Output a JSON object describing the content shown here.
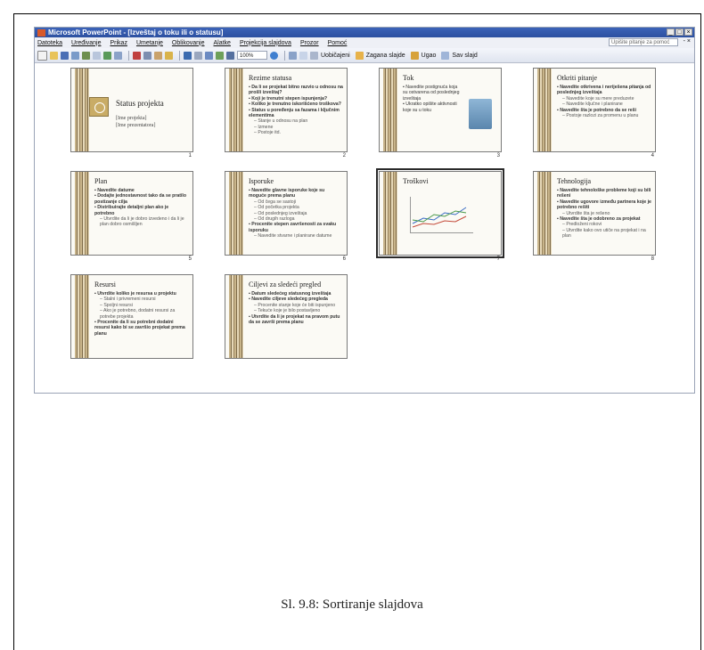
{
  "window": {
    "title": "Microsoft PowerPoint - [Izveštaj o toku ili o statusu]",
    "controls": [
      "_",
      "□",
      "×"
    ]
  },
  "menu": {
    "items": [
      "Datoteka",
      "Uređivanje",
      "Prikaz",
      "Umetanje",
      "Oblikovanje",
      "Alatke",
      "Projekcija slajdova",
      "Prozor",
      "Pomoć"
    ],
    "ask_placeholder": "Upišite pitanje za pomoć",
    "close_doc": "- ×"
  },
  "toolbar": {
    "zoom": "100%",
    "labels": [
      "Uobičajeni",
      "Zagana slajde",
      "Ugao",
      "Sav slajd"
    ]
  },
  "slides": [
    {
      "num": "1",
      "title": "Status projekta",
      "subtitle": [
        "[Ime projekta]",
        "[Ime prezentatora]"
      ]
    },
    {
      "num": "2",
      "title": "Rezime statusa",
      "bullets": [
        {
          "t": "Da li se projekat bitno razvio u odnosu na prošli izveštaj?",
          "b": true
        },
        {
          "t": "Koji je trenutni stepen ispunjenja?",
          "b": true
        },
        {
          "t": "Koliko je trenutno iskorišćeno troškova?",
          "b": true
        },
        {
          "t": "Status u poređenju sa fazama i ključnim elementima",
          "b": true
        },
        {
          "t": "Stanje u odnosu na plan",
          "b": false
        },
        {
          "t": "Izmene",
          "b": false
        },
        {
          "t": "Postoje itd.",
          "b": false
        }
      ]
    },
    {
      "num": "3",
      "title": "Tok",
      "bullets": [
        {
          "t": "Navedite postignuća koja su ostvarena od poslednjeg izveštaja",
          "b": false
        },
        {
          "t": "Ukratko opišite aktivnosti koje su u toku",
          "b": false
        }
      ]
    },
    {
      "num": "4",
      "title": "Otkriti pitanje",
      "bullets": [
        {
          "t": "Navedite otkrivena i neriješena pitanja od poslednjeg izveštaja",
          "b": true
        },
        {
          "t": "Navedite koje su mere preduzete",
          "b": false
        },
        {
          "t": "Navedite ključne i planirane",
          "b": false
        },
        {
          "t": "Navedite šta je potrebno da se reši",
          "b": true
        },
        {
          "t": "Postoje razlozi za promenu u planu",
          "b": false
        }
      ]
    },
    {
      "num": "5",
      "title": "Plan",
      "bullets": [
        {
          "t": "Navedite datume",
          "b": true
        },
        {
          "t": "Dodajte jednostavnost tako da se pratilo postizanje cilja",
          "b": true
        },
        {
          "t": "Distribuirajte detaljni plan ako je potrebno",
          "b": true
        },
        {
          "t": "Utvrdite da li je dobro izvedeno i da li je plan dobro osmišljen",
          "b": false
        }
      ]
    },
    {
      "num": "6",
      "title": "Isporuke",
      "bullets": [
        {
          "t": "Navedite glavne isporuke koje su moguće prema planu",
          "b": true
        },
        {
          "t": "Od čega se sastoji",
          "b": false
        },
        {
          "t": "Od početka projekta",
          "b": false
        },
        {
          "t": "Od poslednjeg izveštaja",
          "b": false
        },
        {
          "t": "Od drugih razloga",
          "b": false
        },
        {
          "t": "Procenite stepen završenosti za svaku isporuku",
          "b": true
        },
        {
          "t": "Navedite stvarne i planirane datume",
          "b": false
        }
      ]
    },
    {
      "num": "7",
      "title": "Troškovi",
      "chart": true
    },
    {
      "num": "8",
      "title": "Tehnologija",
      "bullets": [
        {
          "t": "Navedite tehnološke probleme koji su bili rešeni",
          "b": true
        },
        {
          "t": "Navedite ugovore između partnera koje je potrebno rešiti",
          "b": true
        },
        {
          "t": "Utvrdite šta je rešeno",
          "b": false
        },
        {
          "t": "Navedite šta je odobreno za projekat",
          "b": true
        },
        {
          "t": "Predloženi rokovi",
          "b": false
        },
        {
          "t": "Utvrdite kako ovo utiče na projekat i na plan",
          "b": false
        }
      ]
    },
    {
      "num": "9",
      "title": "Resursi",
      "bullets": [
        {
          "t": "Utvrdite koliko je resursa u projektu",
          "b": true
        },
        {
          "t": "Stalni i privremeni resursi",
          "b": false
        },
        {
          "t": "Spoljni resursi",
          "b": false
        },
        {
          "t": "Ako je potrebno, dodatni resursi za potrebe projekta",
          "b": false
        },
        {
          "t": "Procenite da li su potrebni dodatni resursi kako bi se završio projekat prema planu",
          "b": true
        }
      ]
    },
    {
      "num": "10",
      "title": "Ciljevi za sledeći pregled",
      "bullets": [
        {
          "t": "Datum sledećeg statusnog izveštaja",
          "b": true
        },
        {
          "t": "Navedite ciljeve sledećeg pregleda",
          "b": true
        },
        {
          "t": "Procenite stanje koje će biti ispunjeno",
          "b": false
        },
        {
          "t": "Tekuće koje je bilo postavljeno",
          "b": false
        },
        {
          "t": "Utvrdite da li je projekat na pravom putu da se završi prema planu",
          "b": true
        }
      ]
    }
  ],
  "caption": "Sl. 9.8: Sortiranje slajdova"
}
